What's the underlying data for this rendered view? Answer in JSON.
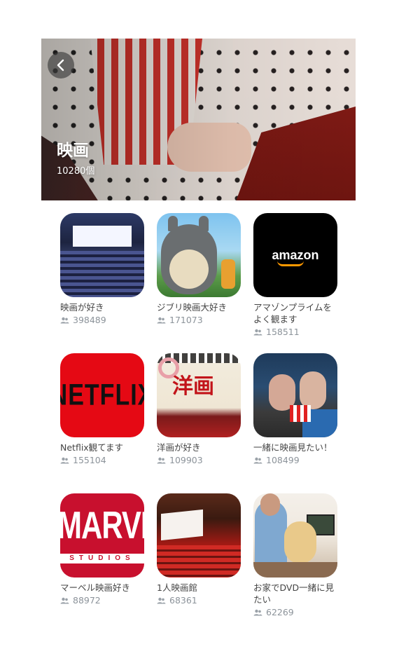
{
  "header": {
    "title": "映画",
    "count_text": "10280個"
  },
  "communities": [
    {
      "title": "映画が好き",
      "members": "398489",
      "thumb": "theater"
    },
    {
      "title": "ジブリ映画大好き",
      "members": "171073",
      "thumb": "totoro"
    },
    {
      "title": "アマゾンプライムをよく観ます",
      "members": "158511",
      "thumb": "amazon"
    },
    {
      "title": "Netflix観てます",
      "members": "155104",
      "thumb": "netflix"
    },
    {
      "title": "洋画が好き",
      "members": "109903",
      "thumb": "yoga"
    },
    {
      "title": "一緒に映画見たい！",
      "members": "108499",
      "thumb": "couple"
    },
    {
      "title": "マーベル映画好き",
      "members": "88972",
      "thumb": "marvel"
    },
    {
      "title": "1人映画館",
      "members": "68361",
      "thumb": "solo"
    },
    {
      "title": "お家でDVD一緒に見たい",
      "members": "62269",
      "thumb": "home"
    }
  ],
  "thumb_text": {
    "amazon": "amazon",
    "netflix": "NETFLIX",
    "yoga": "洋画",
    "marvel": "MARVEL",
    "marvel_sub": "STUDIOS"
  },
  "colors": {
    "count_gray": "#8c939a",
    "netflix_red": "#e50914",
    "marvel_red": "#c8102e",
    "amazon_orange": "#ff9900"
  }
}
